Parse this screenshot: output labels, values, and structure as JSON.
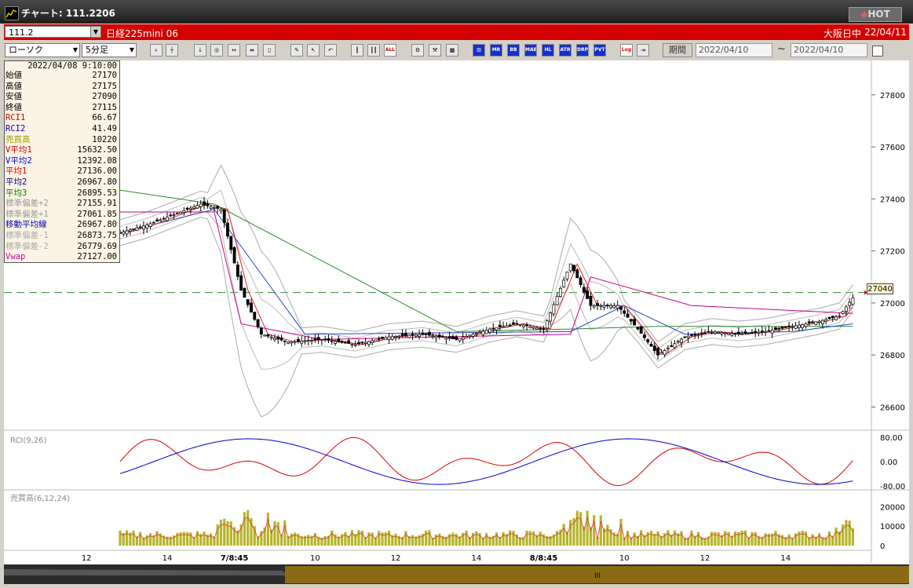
{
  "window": {
    "title": "チャート: 111.2206",
    "hot_label": "HOT"
  },
  "symbol": {
    "code": "111.2",
    "name": "日経225mini 06",
    "market": "大阪日中",
    "date": "22/04/11"
  },
  "toolbar": {
    "chart_type": "ローソク",
    "interval": "5分足",
    "period_label": "期間",
    "date_from": "2022/04/10",
    "date_to": "2022/04/10",
    "tilde": "~",
    "buttons": [
      "ALL",
      "MR",
      "BB",
      "MAE",
      "HL",
      "ATR",
      "DRPR",
      "PVT",
      "Log"
    ]
  },
  "info_panel": {
    "datetime": "2022/04/08 9:10:00",
    "rows": [
      {
        "label": "始値",
        "value": "27170",
        "color": "#000000"
      },
      {
        "label": "高値",
        "value": "27175",
        "color": "#000000"
      },
      {
        "label": "安値",
        "value": "27090",
        "color": "#000000"
      },
      {
        "label": "終値",
        "value": "27115",
        "color": "#000000"
      },
      {
        "label": "RCI1",
        "value": "66.67",
        "color": "#cc0000"
      },
      {
        "label": "RCI2",
        "value": "41.49",
        "color": "#0000aa"
      },
      {
        "label": "売買高",
        "value": "10220",
        "color": "#999900"
      },
      {
        "label": "V平均1",
        "value": "15632.50",
        "color": "#cc0000"
      },
      {
        "label": "V平均2",
        "value": "12392.08",
        "color": "#0000cc"
      },
      {
        "label": "平均1",
        "value": "27136.00",
        "color": "#dd0000"
      },
      {
        "label": "平均2",
        "value": "26967.80",
        "color": "#000080"
      },
      {
        "label": "平均3",
        "value": "26895.53",
        "color": "#007700"
      },
      {
        "label": "標準偏差+2",
        "value": "27155.91",
        "color": "#999999"
      },
      {
        "label": "標準偏差+1",
        "value": "27061.85",
        "color": "#999999"
      },
      {
        "label": "移動平均線",
        "value": "26967.80",
        "color": "#0000aa"
      },
      {
        "label": "標準偏差-1",
        "value": "26873.75",
        "color": "#aaaaaa"
      },
      {
        "label": "標準偏差-2",
        "value": "26779.69",
        "color": "#aaaaaa"
      },
      {
        "label": "Vwap",
        "value": "27127.00",
        "color": "#cc00aa"
      }
    ]
  },
  "current_price": "27040",
  "rci_label": "RCI(9,26)",
  "volume_label": "売買高(6,12,24)",
  "chart_data": {
    "type": "candlestick",
    "price_ticks": [
      "27800",
      "27600",
      "27400",
      "27200",
      "27000",
      "26800",
      "26600"
    ],
    "price_range": [
      26520,
      27890
    ],
    "rci_ticks": [
      "80.00",
      "0.00",
      "-80.00"
    ],
    "volume_ticks": [
      "20000",
      "10000",
      "0"
    ],
    "time_ticks": [
      "12",
      "14",
      "7/8:45",
      "10",
      "12",
      "14",
      "8/8:45",
      "10",
      "12",
      "14"
    ],
    "close_path": [
      [
        0,
        27270
      ],
      [
        8,
        27300
      ],
      [
        16,
        27340
      ],
      [
        24,
        27380
      ],
      [
        30,
        27360
      ],
      [
        36,
        27050
      ],
      [
        42,
        26880
      ],
      [
        50,
        26850
      ],
      [
        60,
        26860
      ],
      [
        70,
        26840
      ],
      [
        80,
        26870
      ],
      [
        90,
        26880
      ],
      [
        100,
        26860
      ],
      [
        110,
        26900
      ],
      [
        118,
        26920
      ],
      [
        126,
        26900
      ],
      [
        134,
        27150
      ],
      [
        140,
        26990
      ],
      [
        148,
        26990
      ],
      [
        154,
        26900
      ],
      [
        160,
        26800
      ],
      [
        168,
        26870
      ],
      [
        176,
        26890
      ],
      [
        184,
        26880
      ],
      [
        192,
        26890
      ],
      [
        200,
        26910
      ],
      [
        208,
        26930
      ],
      [
        214,
        26950
      ],
      [
        218,
        27020
      ]
    ],
    "candle_count": 220
  }
}
